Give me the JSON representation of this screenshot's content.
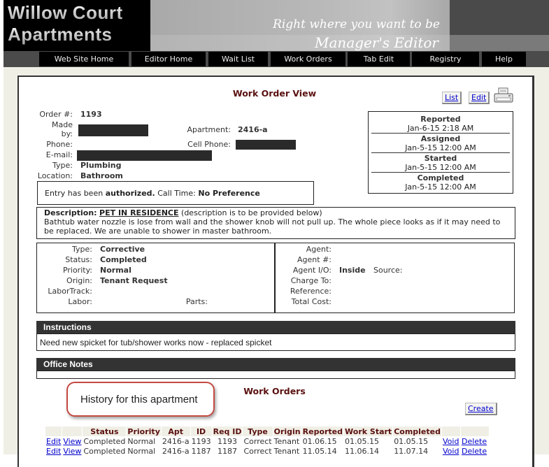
{
  "header": {
    "logo_line1": "Willow Court",
    "logo_line2": "Apartments",
    "tagline": "Right where you want to be",
    "subtitle": "Manager's Editor"
  },
  "nav": [
    {
      "label": "Web Site Home"
    },
    {
      "label": "Editor Home"
    },
    {
      "label": "Wait List"
    },
    {
      "label": "Work Orders"
    },
    {
      "label": "Tab Edit"
    },
    {
      "label": "Registry"
    },
    {
      "label": "Help"
    }
  ],
  "page": {
    "title": "Work Order View",
    "list_button": "List",
    "edit_button": "Edit",
    "print_icon": "printer-icon"
  },
  "order": {
    "order_no_label": "Order #:",
    "order_no": "1193",
    "made_by_label_1": "Made",
    "made_by_label_2": "by:",
    "phone_label": "Phone:",
    "email_label": "E-mail:",
    "type_label": "Type:",
    "type": "Plumbing",
    "location_label": "Location:",
    "location": "Bathroom",
    "apartment_label": "Apartment:",
    "apartment": "2416-a",
    "cell_phone_label": "Cell Phone:"
  },
  "dates": [
    {
      "label": "Reported",
      "value": "Jan-6-15 2:18 AM"
    },
    {
      "label": "Assigned",
      "value": "Jan-5-15 12:00 AM"
    },
    {
      "label": "Started",
      "value": "Jan-5-15 12:00 AM"
    },
    {
      "label": "Completed",
      "value": "Jan-5-15 12:00 AM"
    }
  ],
  "entry": {
    "prefix": "Entry has been ",
    "status": "authorized.",
    "call_time_label": " Call Time: ",
    "call_time": "No Preference"
  },
  "description": {
    "label": "Description:",
    "flag": "PET IN RESIDENCE",
    "note": " (description is to be provided below)",
    "text": "Bathtub water nozzle is lose from wall and the shower knob will not pull up. The whole piece looks as if it may need to be replaced. We are unable to shower in master bathroom."
  },
  "details_left": {
    "type_label": "Type:",
    "type": "Corrective",
    "status_label": "Status:",
    "status": "Completed",
    "priority_label": "Priority:",
    "priority": "Normal",
    "origin_label": "Origin:",
    "origin": "Tenant Request",
    "labortrack_label": "LaborTrack:",
    "labor_label": "Labor:",
    "parts_label": "Parts:"
  },
  "details_right": {
    "agent_label": "Agent:",
    "agent_no_label": "Agent #:",
    "agent_io_label": "Agent I/O:",
    "agent_io": "Inside",
    "source_label": "Source:",
    "charge_to_label": "Charge To:",
    "reference_label": "Reference:",
    "total_cost_label": "Total Cost:"
  },
  "instructions": {
    "header": "Instructions",
    "text": "Need new spicket for tub/shower works now - replaced spicket"
  },
  "office_notes": {
    "header": "Office Notes",
    "text": ""
  },
  "callout": "History for this apartment",
  "work_orders": {
    "title": "Work Orders",
    "create_button": "Create",
    "columns": [
      "",
      "",
      "Status",
      "Priority",
      "Apt",
      "ID",
      "Req ID",
      "Type",
      "Origin",
      "Reported",
      "Work Start",
      "Completed",
      "",
      ""
    ],
    "rows": [
      {
        "edit": "Edit",
        "view": "View",
        "status": "Completed",
        "priority": "Normal",
        "apt": "2416-a",
        "id": "1193",
        "req_id": "1193",
        "type": "Correct",
        "origin": "Tenant",
        "reported": "01.06.15",
        "work_start": "01.05.15",
        "completed": "01.05.15",
        "void": "Void",
        "delete": "Delete"
      },
      {
        "edit": "Edit",
        "view": "View",
        "status": "Completed",
        "priority": "Normal",
        "apt": "2416-a",
        "id": "1187",
        "req_id": "1187",
        "type": "Correct",
        "origin": "Tenant",
        "reported": "11.05.14",
        "work_start": "11.06.14",
        "completed": "11.07.14",
        "void": "Void",
        "delete": "Delete"
      }
    ]
  }
}
